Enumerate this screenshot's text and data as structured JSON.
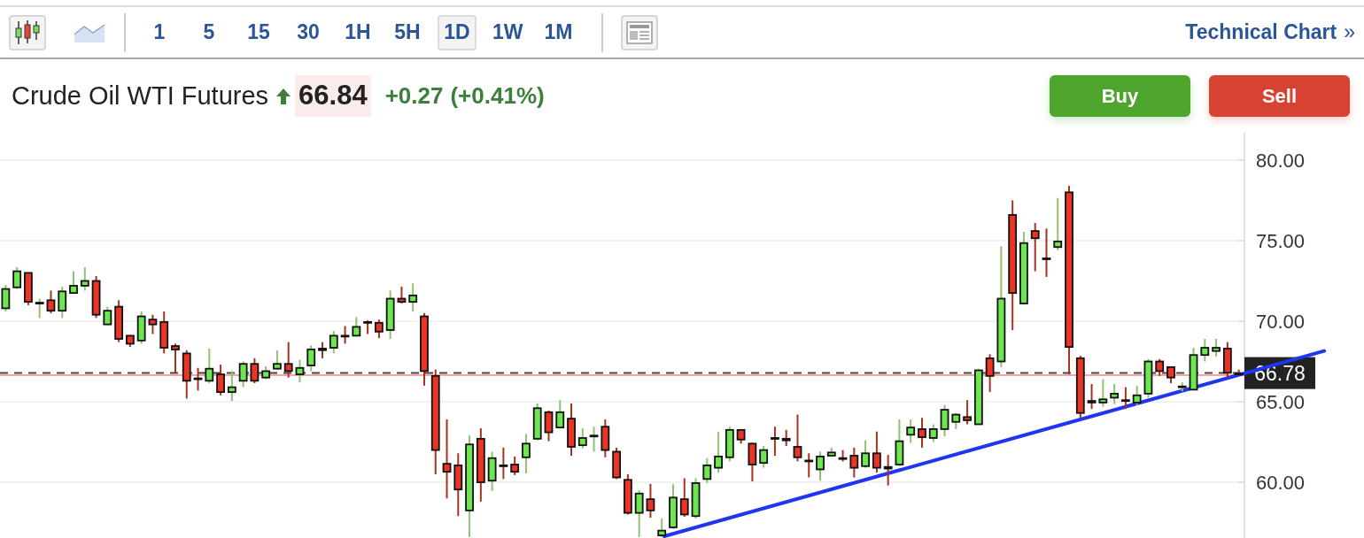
{
  "toolbar": {
    "chart_types": [
      {
        "kind": "candlestick",
        "selected": true
      },
      {
        "kind": "area",
        "selected": false
      }
    ],
    "intervals": [
      {
        "label": "1",
        "selected": false
      },
      {
        "label": "5",
        "selected": false
      },
      {
        "label": "15",
        "selected": false
      },
      {
        "label": "30",
        "selected": false
      },
      {
        "label": "1H",
        "selected": false
      },
      {
        "label": "5H",
        "selected": false
      },
      {
        "label": "1D",
        "selected": true
      },
      {
        "label": "1W",
        "selected": false
      },
      {
        "label": "1M",
        "selected": false
      }
    ],
    "link": "Technical Chart",
    "link_chevron": "»"
  },
  "quote": {
    "name": "Crude Oil WTI Futures",
    "rising": true,
    "price": "66.84",
    "change": "+0.27",
    "change_percent": "(+0.41%)"
  },
  "actions": [
    {
      "label": "Buy",
      "kind": "buy"
    },
    {
      "label": "Sell",
      "kind": "sell"
    }
  ],
  "chart": {
    "chart_data": {
      "type": "candlestick",
      "grid": true,
      "ylim": [
        56.54,
        81.7
      ],
      "yticks": [
        {
          "value": 60,
          "label": "60.00"
        },
        {
          "value": 65,
          "label": "65.00"
        },
        {
          "value": 70,
          "label": "70.00"
        },
        {
          "value": 75,
          "label": "75.00"
        },
        {
          "value": 80,
          "label": "80.00"
        }
      ],
      "ohlc": [
        [
          70.8,
          72.25,
          70.6,
          72.0
        ],
        [
          72.1,
          73.35,
          72.0,
          73.1
        ],
        [
          73.0,
          73.0,
          71.0,
          71.2
        ],
        [
          71.1,
          71.4,
          70.2,
          71.15
        ],
        [
          71.3,
          71.9,
          70.5,
          70.65
        ],
        [
          70.65,
          72.15,
          70.2,
          71.85
        ],
        [
          71.75,
          73.1,
          71.7,
          72.2
        ],
        [
          72.2,
          73.35,
          71.9,
          72.5
        ],
        [
          72.5,
          72.8,
          70.2,
          70.4
        ],
        [
          69.8,
          70.9,
          69.8,
          70.65
        ],
        [
          70.9,
          71.3,
          68.7,
          68.9
        ],
        [
          69.1,
          69.1,
          68.4,
          68.6
        ],
        [
          68.8,
          70.6,
          68.6,
          70.3
        ],
        [
          70.1,
          70.4,
          69.2,
          69.8
        ],
        [
          69.95,
          70.6,
          68.0,
          68.35
        ],
        [
          68.46,
          68.6,
          66.8,
          68.24
        ],
        [
          68.0,
          68.2,
          65.2,
          66.3
        ],
        [
          66.45,
          67.1,
          65.7,
          66.4
        ],
        [
          66.3,
          68.3,
          66.15,
          67.05
        ],
        [
          66.7,
          67.3,
          65.4,
          65.6
        ],
        [
          65.6,
          66.9,
          65.05,
          65.9
        ],
        [
          66.3,
          67.5,
          65.9,
          67.35
        ],
        [
          67.35,
          67.7,
          66.15,
          66.3
        ],
        [
          66.5,
          67.2,
          66.4,
          66.9
        ],
        [
          67.05,
          68.2,
          67.0,
          67.35
        ],
        [
          67.35,
          68.7,
          66.5,
          66.9
        ],
        [
          66.7,
          67.6,
          66.2,
          67.1
        ],
        [
          67.25,
          68.5,
          66.9,
          68.25
        ],
        [
          68.3,
          68.7,
          67.7,
          68.2
        ],
        [
          68.35,
          69.4,
          68.0,
          69.1
        ],
        [
          69.1,
          69.7,
          68.6,
          69.05
        ],
        [
          69.1,
          70.25,
          69.05,
          69.65
        ],
        [
          69.95,
          70.05,
          69.2,
          69.9
        ],
        [
          69.9,
          70.1,
          68.95,
          69.35
        ],
        [
          69.45,
          71.9,
          68.9,
          71.4
        ],
        [
          71.4,
          72.15,
          71.1,
          71.2
        ],
        [
          71.2,
          72.35,
          70.6,
          71.6
        ],
        [
          70.3,
          70.5,
          66.0,
          66.9
        ],
        [
          66.6,
          67.0,
          60.5,
          62.0
        ],
        [
          61.15,
          63.9,
          59.0,
          60.65
        ],
        [
          61.05,
          61.8,
          57.9,
          59.55
        ],
        [
          58.25,
          62.9,
          56.6,
          62.35
        ],
        [
          62.7,
          63.35,
          58.8,
          60.0
        ],
        [
          60.1,
          61.9,
          59.45,
          61.5
        ],
        [
          61.05,
          62.15,
          60.2,
          61.0
        ],
        [
          61.1,
          61.6,
          60.45,
          60.65
        ],
        [
          61.55,
          63.0,
          60.55,
          62.4
        ],
        [
          62.7,
          64.9,
          62.6,
          64.6
        ],
        [
          64.35,
          64.45,
          62.55,
          63.1
        ],
        [
          63.4,
          65.1,
          63.4,
          64.35
        ],
        [
          63.95,
          64.9,
          61.65,
          62.2
        ],
        [
          62.3,
          63.35,
          62.1,
          62.75
        ],
        [
          62.85,
          63.45,
          61.9,
          62.9
        ],
        [
          63.45,
          63.9,
          61.55,
          62.0
        ],
        [
          61.9,
          62.15,
          60.2,
          60.3
        ],
        [
          60.15,
          60.5,
          58.0,
          58.1
        ],
        [
          58.1,
          59.5,
          56.6,
          59.3
        ],
        [
          58.95,
          59.9,
          57.8,
          58.25
        ],
        [
          56.7,
          57.75,
          56.6,
          57.0
        ],
        [
          57.2,
          59.9,
          57.1,
          59.05
        ],
        [
          58.95,
          60.25,
          57.85,
          58.0
        ],
        [
          57.9,
          60.25,
          57.75,
          59.95
        ],
        [
          60.2,
          61.5,
          59.95,
          61.05
        ],
        [
          60.9,
          63.15,
          60.6,
          61.6
        ],
        [
          61.55,
          63.45,
          61.3,
          63.25
        ],
        [
          63.25,
          63.3,
          62.4,
          62.65
        ],
        [
          62.4,
          62.45,
          60.05,
          61.1
        ],
        [
          61.2,
          62.25,
          60.9,
          62.0
        ],
        [
          62.75,
          63.45,
          61.65,
          62.7
        ],
        [
          62.7,
          63.25,
          62.25,
          62.6
        ],
        [
          62.2,
          64.2,
          61.3,
          61.55
        ],
        [
          61.35,
          61.8,
          60.3,
          61.3
        ],
        [
          60.8,
          61.9,
          60.1,
          61.6
        ],
        [
          61.65,
          62.15,
          61.6,
          61.85
        ],
        [
          61.5,
          62.0,
          61.3,
          61.45
        ],
        [
          61.65,
          62.15,
          60.3,
          60.9
        ],
        [
          61.0,
          62.6,
          60.9,
          61.8
        ],
        [
          61.8,
          63.15,
          60.6,
          60.9
        ],
        [
          60.95,
          61.7,
          59.8,
          60.85
        ],
        [
          61.1,
          63.9,
          61.0,
          62.55
        ],
        [
          62.95,
          63.9,
          62.45,
          63.4
        ],
        [
          63.3,
          64.0,
          62.15,
          62.8
        ],
        [
          62.75,
          63.6,
          62.5,
          63.3
        ],
        [
          63.3,
          64.8,
          62.85,
          64.5
        ],
        [
          63.75,
          64.3,
          63.3,
          64.2
        ],
        [
          64.05,
          65.1,
          63.6,
          63.85
        ],
        [
          63.6,
          67.05,
          63.6,
          66.95
        ],
        [
          67.7,
          67.95,
          65.6,
          66.6
        ],
        [
          67.5,
          74.65,
          67.15,
          71.4
        ],
        [
          76.6,
          77.5,
          69.45,
          71.75
        ],
        [
          71.1,
          75.55,
          71.05,
          74.85
        ],
        [
          75.6,
          76.1,
          73.1,
          75.15
        ],
        [
          73.9,
          75.75,
          72.75,
          73.85
        ],
        [
          74.6,
          77.65,
          74.4,
          74.95
        ],
        [
          78.0,
          78.4,
          66.7,
          68.4
        ],
        [
          67.7,
          67.85,
          64.0,
          64.3
        ],
        [
          65.05,
          66.1,
          64.55,
          64.95
        ],
        [
          64.95,
          66.4,
          64.7,
          65.15
        ],
        [
          65.25,
          66.1,
          64.85,
          65.5
        ],
        [
          65.1,
          65.9,
          64.55,
          65.05
        ],
        [
          64.95,
          66.0,
          64.8,
          65.4
        ],
        [
          65.5,
          67.65,
          65.25,
          67.5
        ],
        [
          67.5,
          67.65,
          66.6,
          66.9
        ],
        [
          67.15,
          67.2,
          66.15,
          66.5
        ],
        [
          65.9,
          66.2,
          65.65,
          65.95
        ],
        [
          65.75,
          68.35,
          65.7,
          67.9
        ],
        [
          67.9,
          68.9,
          67.5,
          68.35
        ],
        [
          68.15,
          68.9,
          67.8,
          68.35
        ],
        [
          68.3,
          68.7,
          66.5,
          66.8
        ],
        [
          66.75,
          67.0,
          66.65,
          66.7
        ]
      ],
      "ref_lines": [
        {
          "axis": "y",
          "value": 66.78,
          "label": "66.78",
          "color": "#444444"
        },
        {
          "axis": "y",
          "value": 66.65,
          "color": "#f4a6a6"
        }
      ]
    }
  }
}
